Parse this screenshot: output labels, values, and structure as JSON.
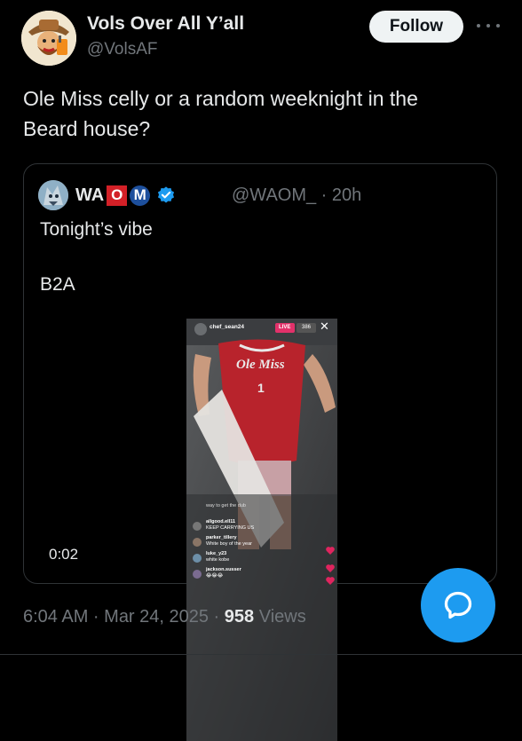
{
  "author": {
    "display_name": "Vols Over All Y’all",
    "handle": "@VolsAF",
    "avatar_icon": "cartoon-mascot-avatar"
  },
  "follow_label": "Follow",
  "tweet_text": "Ole Miss celly or a random weeknight in the\nBeard house?",
  "quote": {
    "name_prefix": "WA",
    "name_o": "O",
    "name_m": "M",
    "handle_time": "@WAOM_ · 20h",
    "line1": "Tonight’s vibe",
    "line2": "B2A",
    "video": {
      "timer": "0:02",
      "streamer": "chef_sean24",
      "live_badge": "LIVE",
      "viewers": "386",
      "jersey_text": "Ole Miss",
      "jersey_number": "1",
      "comments": [
        {
          "user": "",
          "text": "way to get the dub"
        },
        {
          "user": "allgood.ell11",
          "text": "KEEP CARRYING US"
        },
        {
          "user": "parker_tillery",
          "text": "White boy of the year"
        },
        {
          "user": "luke_y23",
          "text": "white kobe"
        },
        {
          "user": "jackson.susser",
          "text": "😂😂😂"
        }
      ]
    }
  },
  "meta": {
    "time": "6:04 AM · Mar 24, 2025 · ",
    "views_count": "958",
    "views_label": " Views"
  },
  "colors": {
    "background": "#000000",
    "primary_text": "#e7e9ea",
    "secondary_text": "#71767b",
    "accent": "#1d9bf0",
    "ole_miss_red": "#d32027",
    "ole_miss_blue": "#1d4f9c"
  }
}
